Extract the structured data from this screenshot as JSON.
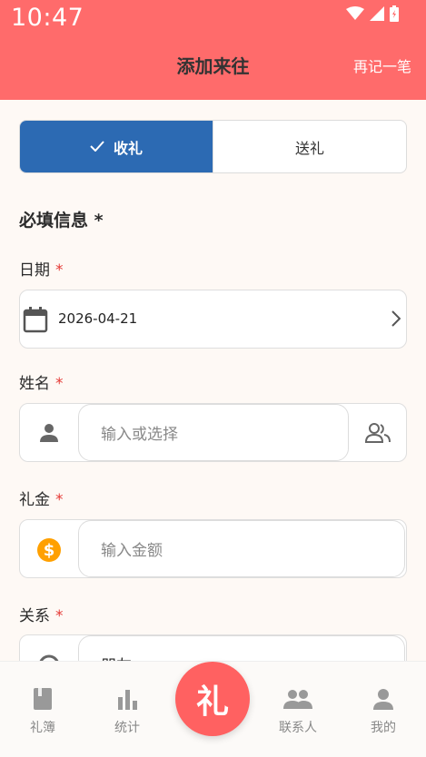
{
  "status_bar": {
    "time": "10:47"
  },
  "header": {
    "title": "添加来往",
    "action": "再记一笔"
  },
  "segment": {
    "receive": "收礼",
    "send": "送礼",
    "selected": "receive"
  },
  "form": {
    "section_title": "必填信息 *",
    "required_mark": "*",
    "date": {
      "label": "日期",
      "value": "2026-04-21"
    },
    "name": {
      "label": "姓名",
      "placeholder": "输入或选择"
    },
    "amount": {
      "label": "礼金",
      "placeholder": "输入金额"
    },
    "relation": {
      "label": "关系",
      "value": "朋友"
    }
  },
  "bottom_nav": {
    "items": [
      {
        "label": "礼簿",
        "icon": "book-icon"
      },
      {
        "label": "统计",
        "icon": "bar-chart-icon"
      },
      {
        "label": "联系人",
        "icon": "people-icon"
      },
      {
        "label": "我的",
        "icon": "person-icon"
      }
    ],
    "fab_label": "礼"
  },
  "colors": {
    "header": "#FF6B6B",
    "accent": "#2C6AB3",
    "required": "#E53935",
    "fab": "#FF6161"
  }
}
